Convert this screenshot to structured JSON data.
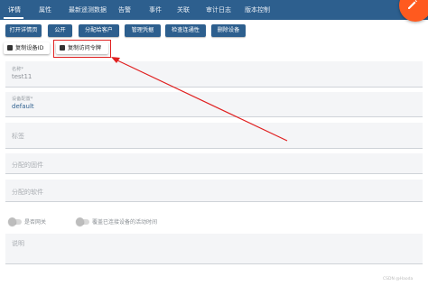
{
  "tabs": [
    "详情",
    "属性",
    "最新遥测数据",
    "告警",
    "事件",
    "关联",
    "审计日志",
    "版本控制"
  ],
  "actions": {
    "open_details": "打开详情页",
    "make_public": "公开",
    "assign_customer": "分配给客户",
    "manage_credentials": "管理凭据",
    "check_connectivity": "检查连通性",
    "delete_device": "删除设备"
  },
  "copy": {
    "copy_device_id": "复制设备ID",
    "copy_access_token": "复制访问令牌"
  },
  "form": {
    "name_label": "名称*",
    "name_value": "test11",
    "profile_label": "设备配置*",
    "profile_value": "default",
    "label_placeholder": "标签",
    "firmware_placeholder": "分配的固件",
    "software_placeholder": "分配的软件",
    "gateway_label": "是否网关",
    "overwrite_activity_label": "覆盖已连接设备的活动时间",
    "description_placeholder": "说明"
  },
  "watermark": "CSDN @Haoda",
  "colors": {
    "tab_bar": "#2d5f8e",
    "button": "#2d5f8e",
    "fab": "#ff5a1f",
    "annotation": "#e02020"
  },
  "icons": [
    "edit-icon",
    "copy-icon",
    "arrow-annotation"
  ]
}
